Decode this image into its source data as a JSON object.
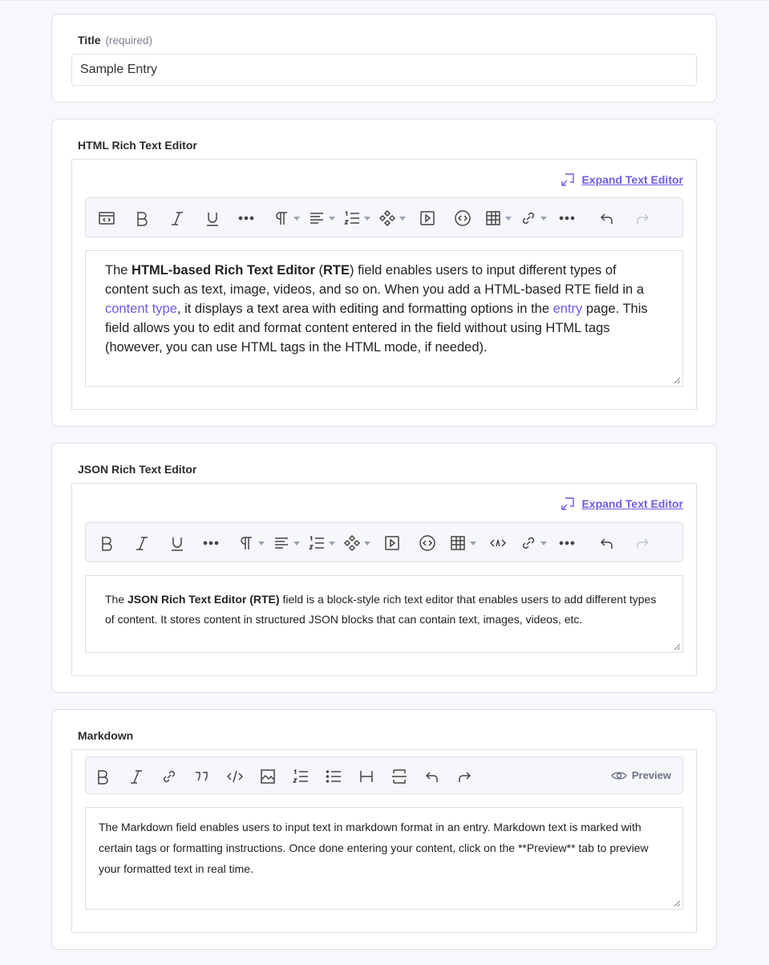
{
  "title_field": {
    "label": "Title",
    "required_note": "(required)",
    "value": "Sample Entry"
  },
  "html_rte": {
    "label": "HTML Rich Text Editor",
    "expand_label": "Expand Text Editor",
    "content": {
      "p1": "The ",
      "b1": "HTML-based Rich Text Editor",
      "p2": " (",
      "b2": "RTE",
      "p3": ") field enables users to input different types of content such as text, image, videos, and so on. When you add a HTML-based RTE field in a ",
      "link1": "content type",
      "p4": ", it displays a text area with editing and formatting options in the ",
      "link2": "entry",
      "p5": " page. This field allows you to edit and format content entered in the field without using HTML tags (however, you can use HTML tags in the HTML mode, if needed)."
    },
    "toolbar_icons": [
      "html-source-icon",
      "bold-icon",
      "italic-icon",
      "underline-icon",
      "more-icon",
      "paragraph-icon",
      "align-icon",
      "list-icon",
      "widget-icon",
      "video-icon",
      "embed-icon",
      "table-icon",
      "link-icon",
      "more-icon",
      "undo-icon",
      "redo-icon"
    ]
  },
  "json_rte": {
    "label": "JSON Rich Text Editor",
    "expand_label": "Expand Text Editor",
    "content": {
      "p1": "The ",
      "b1": "JSON Rich Text Editor (RTE)",
      "p2": " field is a block-style rich text editor that enables users to add different types of content. It stores content in structured JSON blocks that can contain text, images, videos, etc."
    }
  },
  "markdown": {
    "label": "Markdown",
    "preview_label": "Preview",
    "content": "The Markdown field enables users to input text in markdown format in an entry. Markdown text is marked with certain tags or formatting instructions. Once done entering your content, click on the **Preview** tab to preview your formatted text in real time."
  },
  "colors": {
    "accent": "#6c5ce7",
    "background": "#f7f8fc",
    "border": "#dcdfe8"
  }
}
